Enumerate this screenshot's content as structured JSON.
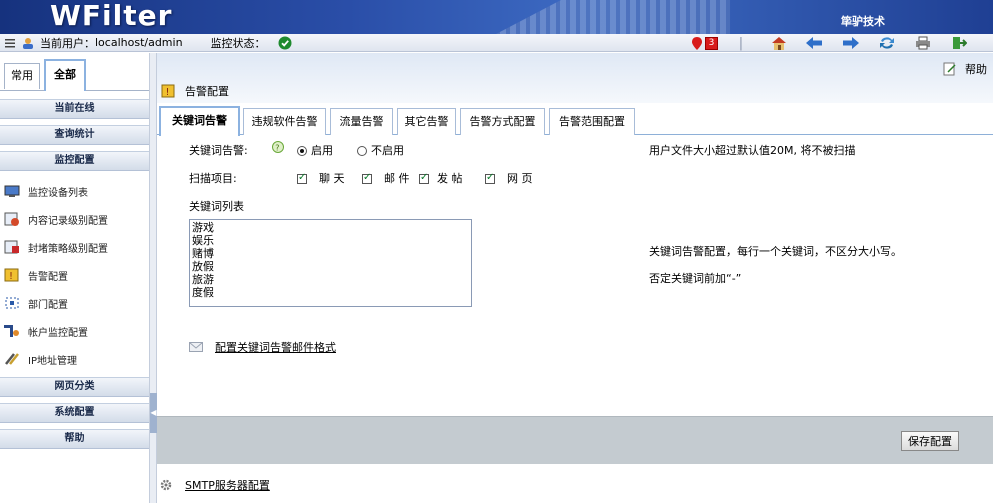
{
  "banner": {
    "logo": "WFilter",
    "company": "筚驴技术"
  },
  "statusbar": {
    "user_label": "当前用户：",
    "user_value": "localhost/admin",
    "monitor_label": "监控状态：",
    "alert_count": "3"
  },
  "toolbar_icons": [
    "home-icon",
    "back-arrow-icon",
    "forward-arrow-icon",
    "refresh-icon",
    "print-icon",
    "exit-icon"
  ],
  "sidebar": {
    "tabs": [
      {
        "label": "常用"
      },
      {
        "label": "全部"
      }
    ],
    "groups_top": [
      {
        "label": "当前在线"
      },
      {
        "label": "查询统计"
      },
      {
        "label": "监控配置"
      }
    ],
    "items": [
      {
        "label": "监控设备列表",
        "icon": "monitor-devices-icon"
      },
      {
        "label": "内容记录级别配置",
        "icon": "content-record-icon"
      },
      {
        "label": "封堵策略级别配置",
        "icon": "block-policy-icon"
      },
      {
        "label": "告警配置",
        "icon": "alert-config-icon"
      },
      {
        "label": "部门配置",
        "icon": "department-icon"
      },
      {
        "label": "帐户监控配置",
        "icon": "account-monitor-icon"
      },
      {
        "label": "IP地址管理",
        "icon": "ip-tools-icon"
      }
    ],
    "groups_bottom": [
      {
        "label": "网页分类"
      },
      {
        "label": "系统配置"
      },
      {
        "label": "帮助"
      }
    ]
  },
  "main": {
    "help_label": "帮助",
    "page_title": "告警配置",
    "tabs": [
      {
        "label": "关键词告警"
      },
      {
        "label": "违规软件告警"
      },
      {
        "label": "流量告警"
      },
      {
        "label": "其它告警"
      },
      {
        "label": "告警方式配置"
      },
      {
        "label": "告警范围配置"
      }
    ],
    "keyword_alert_label": "关键词告警:",
    "enable_label": "启用",
    "disable_label": "不启用",
    "scan_label": "扫描项目:",
    "scan_items": [
      {
        "label": "聊 天"
      },
      {
        "label": "邮 件"
      },
      {
        "label": "发 帖"
      },
      {
        "label": "网 页"
      }
    ],
    "keyword_list_label": "关键词列表",
    "keywords": "游戏\n娱乐\n赌博\n放假\n旅游\n度假",
    "note_filesize": "用户文件大小超过默认值20M, 将不被扫描",
    "note_config": "关键词告警配置，每行一个关键词，不区分大小写。",
    "note_negate": "否定关键词前加“-”",
    "mail_format_link": "配置关键词告警邮件格式",
    "save_button": "保存配置",
    "smtp_link": "SMTP服务器配置"
  }
}
